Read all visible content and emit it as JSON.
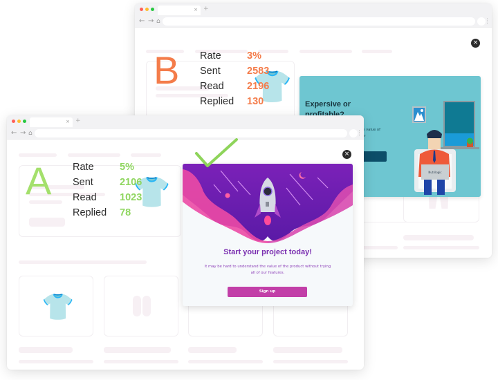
{
  "browser_b": {
    "tab_close": "×",
    "new_tab": "+",
    "nav": {
      "back": "←",
      "forward": "→",
      "home": "⌂",
      "menu": "⋮"
    },
    "variant_letter": "B",
    "accent": "#f47c4a",
    "stats": [
      {
        "label": "Rate",
        "value": "3%"
      },
      {
        "label": "Sent",
        "value": "2583"
      },
      {
        "label": "Read",
        "value": "2196"
      },
      {
        "label": "Replied",
        "value": "130"
      }
    ],
    "popup": {
      "close": "×",
      "title": "Expersive or profitable?",
      "text": "It may be hard to understand the value of Nutrilogic without trying all of our",
      "laptop_brand": "Nutrilogic",
      "bg_color": "#6ec6d1",
      "button_color": "#0c4e69"
    }
  },
  "browser_a": {
    "tab_close": "×",
    "new_tab": "+",
    "nav": {
      "back": "←",
      "forward": "→",
      "home": "⌂",
      "menu": "⋮"
    },
    "variant_letter": "A",
    "accent": "#8fd65f",
    "letter_color": "#a4e06c",
    "stats": [
      {
        "label": "Rate",
        "value": "5%"
      },
      {
        "label": "Sent",
        "value": "2106"
      },
      {
        "label": "Read",
        "value": "1023"
      },
      {
        "label": "Replied",
        "value": "78"
      }
    ],
    "popup": {
      "close": "×",
      "title": "Start your project today!",
      "text": "It may be hard to understand the value of the product without trying all of our features.",
      "button_label": "Sign up",
      "button_color": "#c23fa8"
    }
  },
  "winner_mark": "checkmark",
  "traffic_lights": [
    "#ff5f57",
    "#febc2e",
    "#28c840"
  ]
}
